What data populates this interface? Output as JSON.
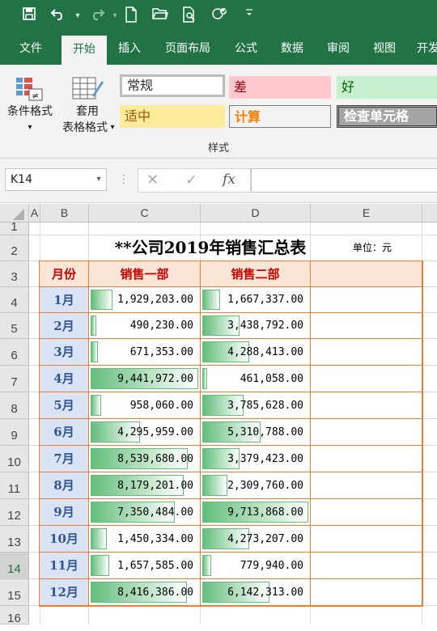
{
  "colors": {
    "accent": "#217346",
    "header_fill": "#fbe5d6",
    "month_fill": "#dae3f3",
    "border": "#ed7d31",
    "databar": "#63be7b"
  },
  "qat_icons": [
    "save-icon",
    "undo-icon",
    "redo-icon",
    "new-file-icon",
    "open-folder-icon",
    "print-preview-icon",
    "touch-mode-icon",
    "customize-qat-icon"
  ],
  "tabs": [
    "文件",
    "开始",
    "插入",
    "页面布局",
    "公式",
    "数据",
    "审阅",
    "视图",
    "开发"
  ],
  "active_tab": "开始",
  "ribbon": {
    "conditional_format_label": "条件格式",
    "table_format_label_1": "套用",
    "table_format_label_2": "表格格式",
    "styles": {
      "normal": "常规",
      "bad": "差",
      "good": "好",
      "neutral": "适中",
      "calculation": "计算",
      "check_cell": "检查单元格"
    },
    "group_label": "样式"
  },
  "formula_bar": {
    "name_box": "K14",
    "fx": "fx",
    "cancel": "✕",
    "enter": "✓",
    "formula": ""
  },
  "columns": [
    "A",
    "B",
    "C",
    "D",
    "E"
  ],
  "rows": [
    "1",
    "2",
    "3",
    "4",
    "5",
    "6",
    "7",
    "8",
    "9",
    "10",
    "11",
    "12",
    "13",
    "14",
    "15",
    "16"
  ],
  "sheet": {
    "title": "**公司2019年销售汇总表",
    "unit": "单位：元",
    "headers": [
      "月份",
      "销售一部",
      "销售二部"
    ],
    "data": [
      {
        "month": "1月",
        "dept1": "1,929,203.00",
        "dept2": "1,667,337.00",
        "v1": 1929203,
        "v2": 1667337
      },
      {
        "month": "2月",
        "dept1": "490,230.00",
        "dept2": "3,438,792.00",
        "v1": 490230,
        "v2": 3438792
      },
      {
        "month": "3月",
        "dept1": "671,353.00",
        "dept2": "4,288,413.00",
        "v1": 671353,
        "v2": 4288413
      },
      {
        "month": "4月",
        "dept1": "9,441,972.00",
        "dept2": "461,058.00",
        "v1": 9441972,
        "v2": 461058
      },
      {
        "month": "5月",
        "dept1": "958,060.00",
        "dept2": "3,785,628.00",
        "v1": 958060,
        "v2": 3785628
      },
      {
        "month": "6月",
        "dept1": "4,295,959.00",
        "dept2": "5,310,788.00",
        "v1": 4295959,
        "v2": 5310788
      },
      {
        "month": "7月",
        "dept1": "8,539,680.00",
        "dept2": "3,379,423.00",
        "v1": 8539680,
        "v2": 3379423
      },
      {
        "month": "8月",
        "dept1": "8,179,201.00",
        "dept2": "2,309,760.00",
        "v1": 8179201,
        "v2": 2309760
      },
      {
        "month": "9月",
        "dept1": "7,350,484.00",
        "dept2": "9,713,868.00",
        "v1": 7350484,
        "v2": 9713868
      },
      {
        "month": "10月",
        "dept1": "1,450,334.00",
        "dept2": "4,273,207.00",
        "v1": 1450334,
        "v2": 4273207
      },
      {
        "month": "11月",
        "dept1": "1,657,585.00",
        "dept2": "779,940.00",
        "v1": 1657585,
        "v2": 779940
      },
      {
        "month": "12月",
        "dept1": "8,416,386.00",
        "dept2": "6,142,313.00",
        "v1": 8416386,
        "v2": 6142313
      }
    ]
  },
  "selected_row": "14"
}
